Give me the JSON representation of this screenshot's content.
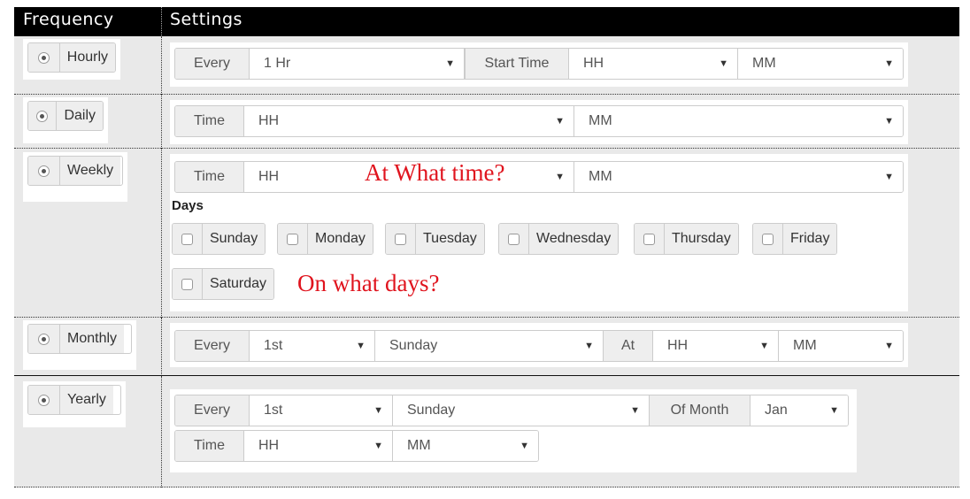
{
  "header": {
    "col_frequency": "Frequency",
    "col_settings": "Settings"
  },
  "hourly": {
    "label": "Hourly",
    "every_label": "Every",
    "every_value": "1 Hr",
    "start_label": "Start Time",
    "hh": "HH",
    "mm": "MM"
  },
  "daily": {
    "label": "Daily",
    "time_label": "Time",
    "hh": "HH",
    "mm": "MM"
  },
  "weekly": {
    "label": "Weekly",
    "time_label": "Time",
    "hh": "HH",
    "mm": "MM",
    "days_label": "Days",
    "days": [
      "Sunday",
      "Monday",
      "Tuesday",
      "Wednesday",
      "Thursday",
      "Friday",
      "Saturday"
    ],
    "note_time": "At What time?",
    "note_days": "On what days?"
  },
  "monthly": {
    "label": "Monthly",
    "every_label": "Every",
    "every_value": "1st",
    "day_value": "Sunday",
    "at_label": "At",
    "hh": "HH",
    "mm": "MM"
  },
  "yearly": {
    "label": "Yearly",
    "every_label": "Every",
    "every_value": "1st",
    "day_value": "Sunday",
    "ofmonth_label": "Of Month",
    "month_value": "Jan",
    "time_label": "Time",
    "hh": "HH",
    "mm": "MM"
  },
  "colors": {
    "header_bg": "#000000",
    "row_bg": "#e9e9e9",
    "note": "#e0141e"
  }
}
